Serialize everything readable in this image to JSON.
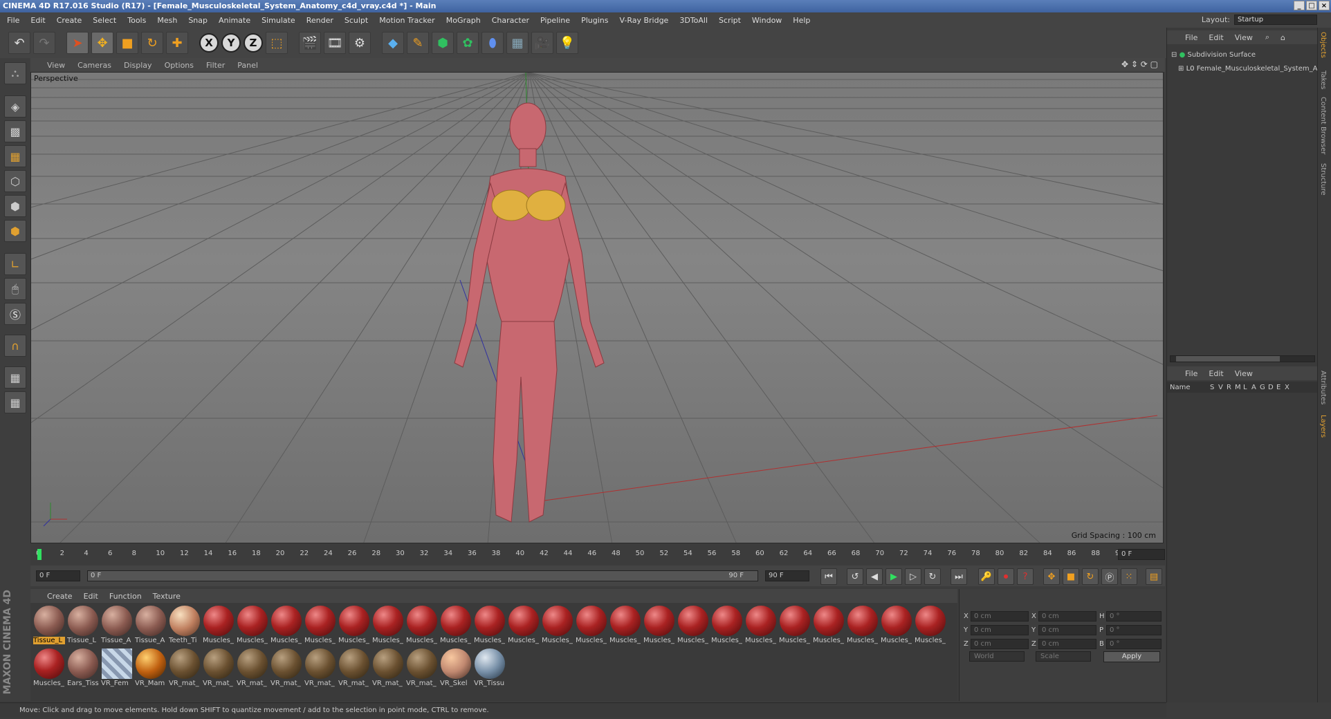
{
  "window": {
    "title": "CINEMA 4D R17.016 Studio (R17) - [Female_Musculoskeletal_System_Anatomy_c4d_vray.c4d *] - Main"
  },
  "menu": [
    "File",
    "Edit",
    "Create",
    "Select",
    "Tools",
    "Mesh",
    "Snap",
    "Animate",
    "Simulate",
    "Render",
    "Sculpt",
    "Motion Tracker",
    "MoGraph",
    "Character",
    "Pipeline",
    "Plugins",
    "V-Ray Bridge",
    "3DToAll",
    "Script",
    "Window",
    "Help"
  ],
  "layout": {
    "label": "Layout:",
    "value": "Startup"
  },
  "toolbar": {
    "x": "X",
    "y": "Y",
    "z": "Z"
  },
  "viewport": {
    "menu": [
      "View",
      "Cameras",
      "Display",
      "Options",
      "Filter",
      "Panel"
    ],
    "label": "Perspective",
    "grid_spacing": "Grid Spacing : 100 cm"
  },
  "timeline": {
    "ticks": [
      "0",
      "2",
      "4",
      "6",
      "8",
      "10",
      "12",
      "14",
      "16",
      "18",
      "20",
      "22",
      "24",
      "26",
      "28",
      "30",
      "32",
      "34",
      "36",
      "38",
      "40",
      "42",
      "44",
      "46",
      "48",
      "50",
      "52",
      "54",
      "56",
      "58",
      "60",
      "62",
      "64",
      "66",
      "68",
      "70",
      "72",
      "74",
      "76",
      "78",
      "80",
      "82",
      "84",
      "86",
      "88",
      "90"
    ],
    "frame_field": "0 F"
  },
  "transport": {
    "start": "0 F",
    "slider_left": "0 F",
    "slider_right": "90 F",
    "end": "90 F"
  },
  "materials": {
    "menu": [
      "Create",
      "Edit",
      "Function",
      "Texture"
    ],
    "row1": [
      "Tissue_L",
      "Tissue_L",
      "Tissue_A",
      "Tissue_A",
      "Teeth_Ti",
      "Muscles_",
      "Muscles_",
      "Muscles_",
      "Muscles_",
      "Muscles_",
      "Muscles_",
      "Muscles_",
      "Muscles_",
      "Muscles_",
      "Muscles_",
      "Muscles_",
      "Muscles_",
      "Muscles_",
      "Muscles_",
      "Muscles_",
      "Muscles_",
      "Muscles_",
      "Muscles_",
      "Muscles_",
      "Muscles_",
      "Muscles_",
      "Muscles_"
    ],
    "row2": [
      "Muscles_",
      "Ears_Tiss",
      "VR_Fem",
      "VR_Mam",
      "VR_mat_",
      "VR_mat_",
      "VR_mat_",
      "VR_mat_",
      "VR_mat_",
      "VR_mat_",
      "VR_mat_",
      "VR_mat_",
      "VR_Skel",
      "VR_Tissu"
    ]
  },
  "coords": {
    "position": [
      {
        "axis": "X",
        "value": "0 cm"
      },
      {
        "axis": "Y",
        "value": "0 cm"
      },
      {
        "axis": "Z",
        "value": "0 cm"
      }
    ],
    "size": [
      {
        "axis": "X",
        "value": "0 cm"
      },
      {
        "axis": "Y",
        "value": "0 cm"
      },
      {
        "axis": "Z",
        "value": "0 cm"
      }
    ],
    "rotation": [
      {
        "axis": "H",
        "value": "0 °"
      },
      {
        "axis": "P",
        "value": "0 °"
      },
      {
        "axis": "B",
        "value": "0 °"
      }
    ],
    "mode": "World",
    "size_mode": "Scale",
    "apply": "Apply"
  },
  "status": "Move: Click and drag to move elements. Hold down SHIFT to quantize movement / add to the selection in point mode, CTRL to remove.",
  "objects": {
    "menu": [
      "File",
      "Edit",
      "View"
    ],
    "items": [
      "Subdivision Surface",
      "Female_Musculoskeletal_System_A"
    ]
  },
  "layers": {
    "menu": [
      "File",
      "Edit",
      "View"
    ],
    "name_col": "Name",
    "flags": [
      "S",
      "V",
      "R",
      "M",
      "L",
      "A",
      "G",
      "D",
      "E",
      "X"
    ]
  },
  "side_tabs": {
    "objects": "Objects",
    "takes": "Takes",
    "content": "Content Browser",
    "structure": "Structure",
    "attributes": "Attributes",
    "layers": "Layers"
  },
  "maxon": "MAXON CINEMA 4D"
}
